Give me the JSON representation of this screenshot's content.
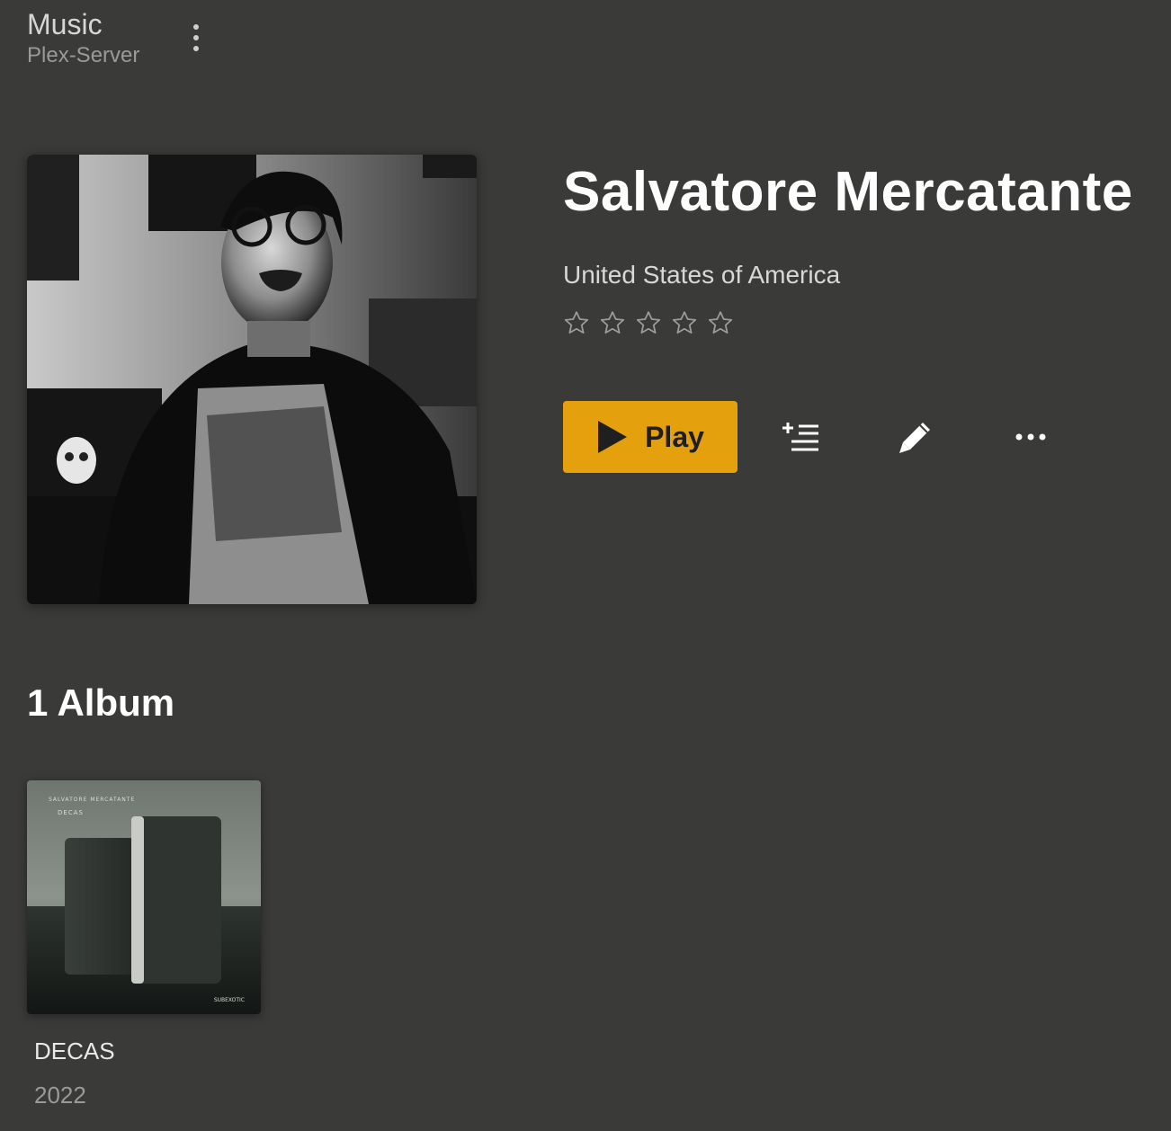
{
  "header": {
    "library_title": "Music",
    "server_name": "Plex-Server"
  },
  "artist": {
    "name": "Salvatore Mercatante",
    "country": "United States of America",
    "rating_stars": 5,
    "rating_value": 0
  },
  "actions": {
    "play_label": "Play"
  },
  "albums_section": {
    "title": "1 Album",
    "albums": [
      {
        "title": "DECAS",
        "year": "2022",
        "cover_artist_text": "SALVATORE MERCATANTE",
        "cover_title_text": "DECAS",
        "cover_label_text": "SUBEXOTIC"
      }
    ]
  },
  "colors": {
    "background": "#3a3a39",
    "accent": "#e5a00d",
    "text_primary": "#ffffff",
    "text_secondary": "#9a9a9a"
  },
  "icons": {
    "menu": "kebab-menu-icon",
    "play": "play-icon",
    "queue": "add-to-queue-icon",
    "edit": "pencil-icon",
    "more": "more-options-icon",
    "rating": "star-outline-icon"
  }
}
